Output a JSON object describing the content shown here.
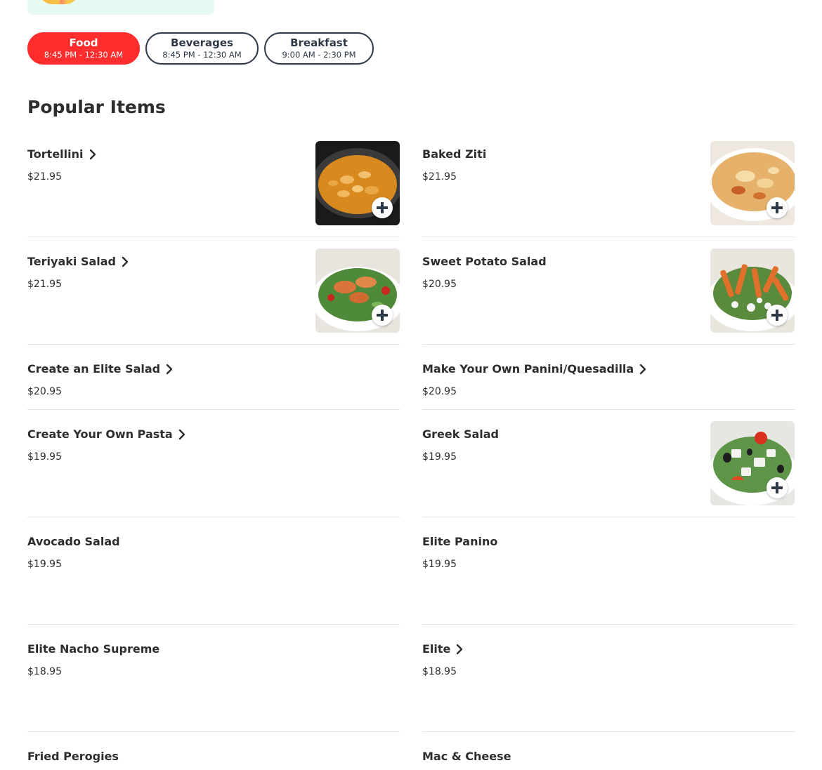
{
  "tabs": [
    {
      "name": "Food",
      "hours": "8:45 PM - 12:30 AM"
    },
    {
      "name": "Beverages",
      "hours": "8:45 PM - 12:30 AM"
    },
    {
      "name": "Breakfast",
      "hours": "9:00 AM - 2:30 PM"
    }
  ],
  "section_title": "Popular Items",
  "items": [
    {
      "name": "Tortellini",
      "price": "$21.95"
    },
    {
      "name": "Baked Ziti",
      "price": "$21.95"
    },
    {
      "name": "Teriyaki Salad",
      "price": "$21.95"
    },
    {
      "name": "Sweet Potato Salad",
      "price": "$20.95"
    },
    {
      "name": "Create an Elite Salad",
      "price": "$20.95"
    },
    {
      "name": "Make Your Own Panini/Quesadilla",
      "price": "$20.95"
    },
    {
      "name": "Create Your Own Pasta",
      "price": "$19.95"
    },
    {
      "name": "Greek Salad",
      "price": "$19.95"
    },
    {
      "name": "Avocado Salad",
      "price": "$19.95"
    },
    {
      "name": "Elite Panino",
      "price": "$19.95"
    },
    {
      "name": "Elite Nacho Supreme",
      "price": "$18.95"
    },
    {
      "name": "Elite",
      "price": "$18.95"
    },
    {
      "name": "Fried Perogies",
      "price": ""
    },
    {
      "name": "Mac & Cheese",
      "price": ""
    }
  ],
  "colors": {
    "accent": "#ff2d2d",
    "tab_border": "#2f3a48",
    "promo_bg": "#e6faf1",
    "divider": "#e2e2e2"
  }
}
